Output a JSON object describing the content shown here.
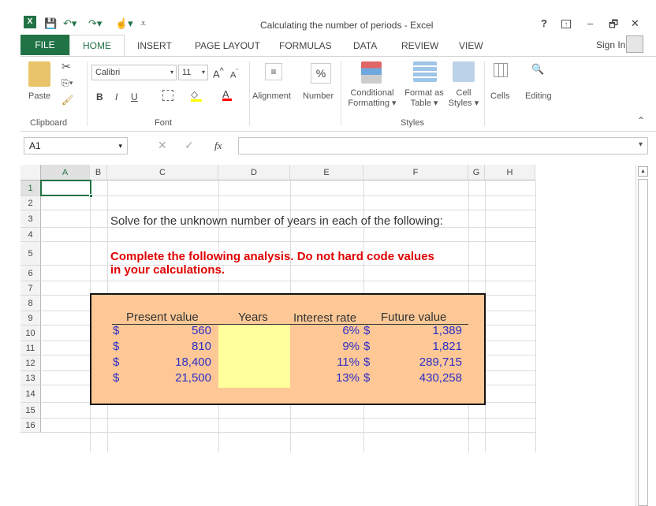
{
  "window": {
    "title": "Calculating the number of periods - Excel",
    "help": "?",
    "minimize": "–",
    "restore": "🗗",
    "close": "✕",
    "sign_in": "Sign In"
  },
  "tabs": [
    "FILE",
    "HOME",
    "INSERT",
    "PAGE LAYOUT",
    "FORMULAS",
    "DATA",
    "REVIEW",
    "VIEW"
  ],
  "ribbon": {
    "paste": "Paste",
    "clipboard": "Clipboard",
    "font_name": "Calibri",
    "font_size": "11",
    "bold": "B",
    "italic": "I",
    "underline": "U",
    "font_group": "Font",
    "alignment": "Alignment",
    "number": "Number",
    "percent": "%",
    "conditional_1": "Conditional",
    "conditional_2": "Formatting",
    "format_as_1": "Format as",
    "format_as_2": "Table",
    "cell_styles_1": "Cell",
    "cell_styles_2": "Styles",
    "styles_group": "Styles",
    "cells": "Cells",
    "editing": "Editing"
  },
  "formula_bar": {
    "name_box": "A1",
    "fx": "fx",
    "value": ""
  },
  "columns": [
    "A",
    "B",
    "C",
    "D",
    "E",
    "F",
    "G",
    "H"
  ],
  "rows": [
    "1",
    "2",
    "3",
    "4",
    "5",
    "6",
    "7",
    "8",
    "9",
    "10",
    "11",
    "12",
    "13",
    "14",
    "15",
    "16"
  ],
  "sheet": {
    "instruction": "Solve for the unknown number of years in each of the following:",
    "warning_1": "Complete the following analysis. Do not hard code values",
    "warning_2": "in your calculations.",
    "headers": [
      "Present value",
      "Years",
      "Interest rate",
      "Future value"
    ],
    "currency": "$",
    "table": [
      {
        "pv": "560",
        "rate": "6%",
        "fv": "1,389"
      },
      {
        "pv": "810",
        "rate": "9%",
        "fv": "1,821"
      },
      {
        "pv": "18,400",
        "rate": "11%",
        "fv": "289,715"
      },
      {
        "pv": "21,500",
        "rate": "13%",
        "fv": "430,258"
      }
    ]
  },
  "colors": {
    "excel_green": "#217346",
    "box_fill": "#fdc896",
    "input_fill": "#ffff9c",
    "warning": "#e00000",
    "blue_text": "#2e2ec6"
  }
}
